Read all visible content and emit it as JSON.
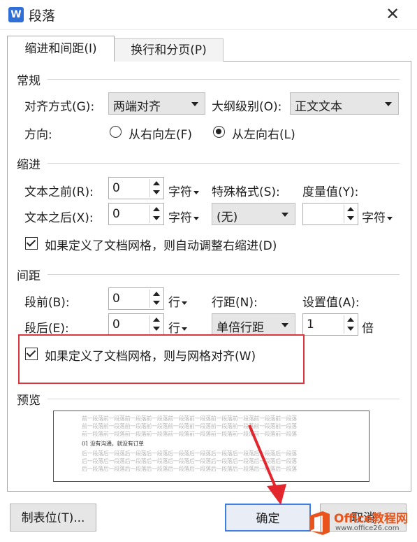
{
  "title": "段落",
  "app_icon_letter": "W",
  "tabs": {
    "indent": "缩进和间距(I)",
    "linebreak": "换行和分页(P)"
  },
  "general": {
    "section": "常规",
    "align_label": "对齐方式(G):",
    "align_value": "两端对齐",
    "outline_label": "大纲级别(O):",
    "outline_value": "正文文本",
    "direction_label": "方向:",
    "rtl_label": "从右向左(F)",
    "ltr_label": "从左向右(L)",
    "direction_selected": "从左向右(L)"
  },
  "indent": {
    "section": "缩进",
    "before_label": "文本之前(R):",
    "before_value": "0",
    "before_unit": "字符",
    "after_label": "文本之后(X):",
    "after_value": "0",
    "after_unit": "字符",
    "special_label": "特殊格式(S):",
    "special_value": "(无)",
    "measure_label": "度量值(Y):",
    "measure_value": "",
    "measure_unit": "字符",
    "auto_adjust_label": "如果定义了文档网格，则自动调整右缩进(D)",
    "auto_adjust_checked": true
  },
  "spacing": {
    "section": "间距",
    "before_label": "段前(B):",
    "before_value": "0",
    "before_unit": "行",
    "after_label": "段后(E):",
    "after_value": "0",
    "after_unit": "行",
    "line_label": "行距(N):",
    "line_value": "单倍行距",
    "setting_label": "设置值(A):",
    "setting_value": "1",
    "setting_unit": "倍",
    "grid_align_label": "如果定义了文档网格，则与网格对齐(W)",
    "grid_align_checked": true
  },
  "preview": {
    "section": "预览",
    "prev_line": "前一段落前一段落前一段落前一段落前一段落前一段落前一段落前一段落前一段落前一段落",
    "sample_line": "01 没有沟通，就没有订单",
    "next_line": "后一段落后一段落后一段落后一段落后一段落后一段落后一段落后一段落后一段落后一段落"
  },
  "buttons": {
    "tabs": "制表位(T)...",
    "ok": "确定",
    "cancel": "取消"
  },
  "watermark": {
    "brand": "Office教程网",
    "url": "www.office26.com"
  },
  "colors": {
    "highlight": "#d9363e",
    "ok_border": "#3c7de0",
    "arrow": "#e3262e",
    "logo_orange": "#e8541b"
  }
}
